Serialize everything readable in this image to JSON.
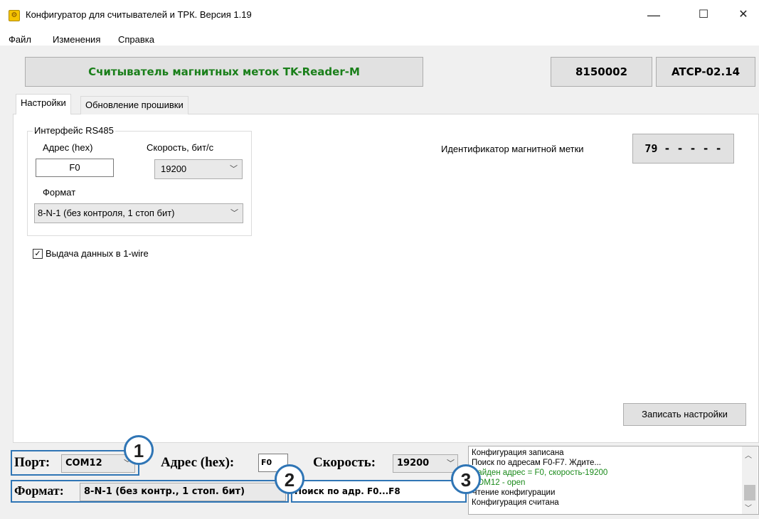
{
  "window": {
    "title": "Конфигуратор  для считывателей и ТРК.  Версия 1.19",
    "minimize": "—",
    "maximize": "☐",
    "close": "✕"
  },
  "menu": [
    "Файл",
    "Изменения",
    "Справка"
  ],
  "header": {
    "device_name": "Считыватель магнитных меток TK-Reader-M",
    "serial": "8150002",
    "firmware": "ATCP-02.14"
  },
  "tabs": [
    "Настройки",
    "Обновление прошивки"
  ],
  "settings": {
    "group_title": "Интерфейс RS485",
    "address_label": "Адрес (hex)",
    "address_value": "F0",
    "speed_label": "Скорость, бит/с",
    "speed_value": "19200",
    "format_label": "Формат",
    "format_value": "8-N-1 (без контроля, 1 стоп бит)",
    "onewire_label": "Выдача данных в 1-wire",
    "onewire_checked": "✓",
    "id_label": "Идентификатор магнитной метки",
    "id_value": "79 - - - - -",
    "save_button": "Записать настройки"
  },
  "status": {
    "port_label": "Порт:",
    "port_value": "COM12",
    "address_label": "Адрес (hex):",
    "address_value": "F0",
    "speed_label": "Скорость:",
    "speed_value": "19200",
    "format_label": "Формат:",
    "format_value": "8-N-1 (без контр., 1 стоп. бит)",
    "search_text": "Поиск по адр. F0...F8"
  },
  "badges": [
    "1",
    "2",
    "3"
  ],
  "log": [
    {
      "text": "Конфигурация записана",
      "color": "#000000"
    },
    {
      "text": "Поиск по адресам F0-F7. Ждите...",
      "color": "#000000"
    },
    {
      "text": "Найден адрес = F0, скорость-19200",
      "color": "#1a8a1a"
    },
    {
      "text": "COM12 - open",
      "color": "#1a8a1a"
    },
    {
      "text": "Чтение конфигурации",
      "color": "#000000"
    },
    {
      "text": "Конфигурация считана",
      "color": "#000000"
    }
  ],
  "colors": {
    "accent_green": "#1a7f1a",
    "highlight_blue": "#2f75b5"
  }
}
